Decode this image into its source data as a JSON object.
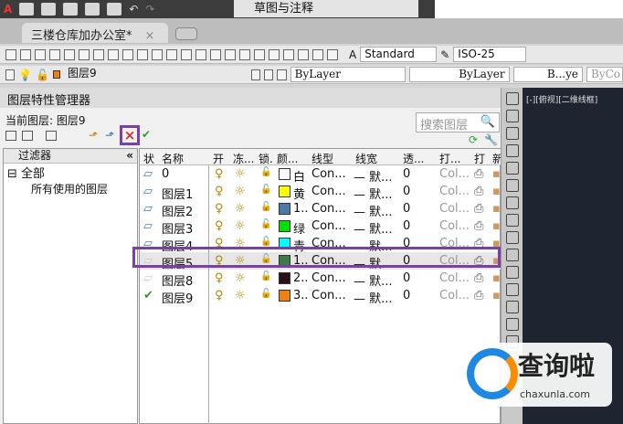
{
  "quick_access": {
    "workspace": "草图与注释"
  },
  "doc_tab": {
    "title": "三楼仓库加办公室*",
    "close": "×"
  },
  "toolbar": {
    "text_style": "Standard",
    "dim_style": "ISO-25"
  },
  "props_bar": {
    "layer": "图层9",
    "color": "ByLayer",
    "linetype": "ByLayer",
    "lineweight": "B...ye",
    "plotstyle": "ByCo"
  },
  "panel": {
    "title": "图层特性管理器",
    "current_layer": "当前图层: 图层9",
    "search_placeholder": "搜索图层",
    "delete_icon": "×"
  },
  "filters": {
    "header": "过滤器",
    "collapse": "«",
    "all": "全部",
    "used": "所有使用的图层"
  },
  "columns": [
    "状",
    "名称",
    "开",
    "冻...",
    "锁.",
    "颜...",
    "线型",
    "线宽",
    "透...",
    "打...",
    "打",
    "新"
  ],
  "layers": [
    {
      "name": "0",
      "color_name": "白",
      "color": "#ffffff",
      "linetype": "Con...",
      "lineweight": "— 默...",
      "transparency": "0",
      "plotstyle": "Col...",
      "status": "layer"
    },
    {
      "name": "图层1",
      "color_name": "黄",
      "color": "#ffff00",
      "linetype": "Con...",
      "lineweight": "— 默...",
      "transparency": "0",
      "plotstyle": "Col...",
      "status": "layer"
    },
    {
      "name": "图层2",
      "color_name": "1..",
      "color": "#4a7aa8",
      "linetype": "Con...",
      "lineweight": "— 默...",
      "transparency": "0",
      "plotstyle": "Col...",
      "status": "layer"
    },
    {
      "name": "图层3",
      "color_name": "绿",
      "color": "#00e000",
      "linetype": "Con...",
      "lineweight": "— 默...",
      "transparency": "0",
      "plotstyle": "Col...",
      "status": "layer"
    },
    {
      "name": "图层4",
      "color_name": "青",
      "color": "#00ffff",
      "linetype": "Con...",
      "lineweight": "— 默...",
      "transparency": "0",
      "plotstyle": "Col...",
      "status": "layer"
    },
    {
      "name": "图层5",
      "color_name": "1..",
      "color": "#3d7a4a",
      "linetype": "Con...",
      "lineweight": "— 默...",
      "transparency": "0",
      "plotstyle": "Col...",
      "status": "unused"
    },
    {
      "name": "图层8",
      "color_name": "2..",
      "color": "#2a1018",
      "linetype": "Con...",
      "lineweight": "— 默...",
      "transparency": "0",
      "plotstyle": "Col...",
      "status": "unused"
    },
    {
      "name": "图层9",
      "color_name": "3..",
      "color": "#f08010",
      "linetype": "Con...",
      "lineweight": "— 默...",
      "transparency": "0",
      "plotstyle": "Col...",
      "status": "current"
    }
  ],
  "viewport": {
    "label": "[-][俯视][二维线框]"
  },
  "watermark": {
    "text": "查询啦",
    "url": "chaxunla.com"
  }
}
